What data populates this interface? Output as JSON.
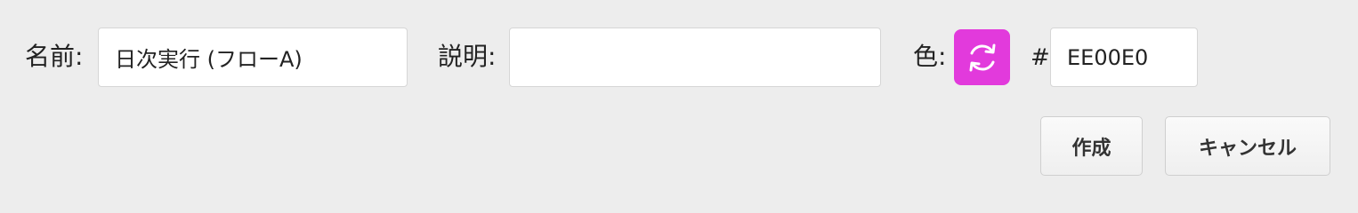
{
  "form": {
    "name_label": "名前:",
    "name_value": "日次実行 (フローA)",
    "description_label": "説明:",
    "description_value": "",
    "color_label": "色:",
    "color_icon": "sync-icon",
    "hash_label": "#",
    "color_hex": "EE00E0"
  },
  "colors": {
    "swatch": "#E23ADC"
  },
  "buttons": {
    "create_label": "作成",
    "cancel_label": "キャンセル"
  }
}
